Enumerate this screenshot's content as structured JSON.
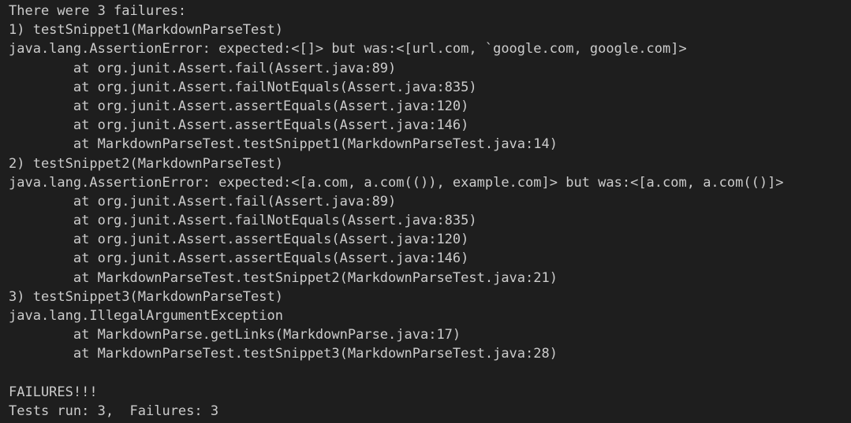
{
  "terminal": {
    "lines": [
      "There were 3 failures:",
      "1) testSnippet1(MarkdownParseTest)",
      "java.lang.AssertionError: expected:<[]> but was:<[url.com, `google.com, google.com]>",
      "        at org.junit.Assert.fail(Assert.java:89)",
      "        at org.junit.Assert.failNotEquals(Assert.java:835)",
      "        at org.junit.Assert.assertEquals(Assert.java:120)",
      "        at org.junit.Assert.assertEquals(Assert.java:146)",
      "        at MarkdownParseTest.testSnippet1(MarkdownParseTest.java:14)",
      "2) testSnippet2(MarkdownParseTest)",
      "java.lang.AssertionError: expected:<[a.com, a.com(()), example.com]> but was:<[a.com, a.com(()]>",
      "        at org.junit.Assert.fail(Assert.java:89)",
      "        at org.junit.Assert.failNotEquals(Assert.java:835)",
      "        at org.junit.Assert.assertEquals(Assert.java:120)",
      "        at org.junit.Assert.assertEquals(Assert.java:146)",
      "        at MarkdownParseTest.testSnippet2(MarkdownParseTest.java:21)",
      "3) testSnippet3(MarkdownParseTest)",
      "java.lang.IllegalArgumentException",
      "        at MarkdownParse.getLinks(MarkdownParse.java:17)",
      "        at MarkdownParseTest.testSnippet3(MarkdownParseTest.java:28)",
      "",
      "FAILURES!!!",
      "Tests run: 3,  Failures: 3"
    ]
  },
  "colors": {
    "background": "#1e1e1e",
    "text": "#cccccc"
  }
}
